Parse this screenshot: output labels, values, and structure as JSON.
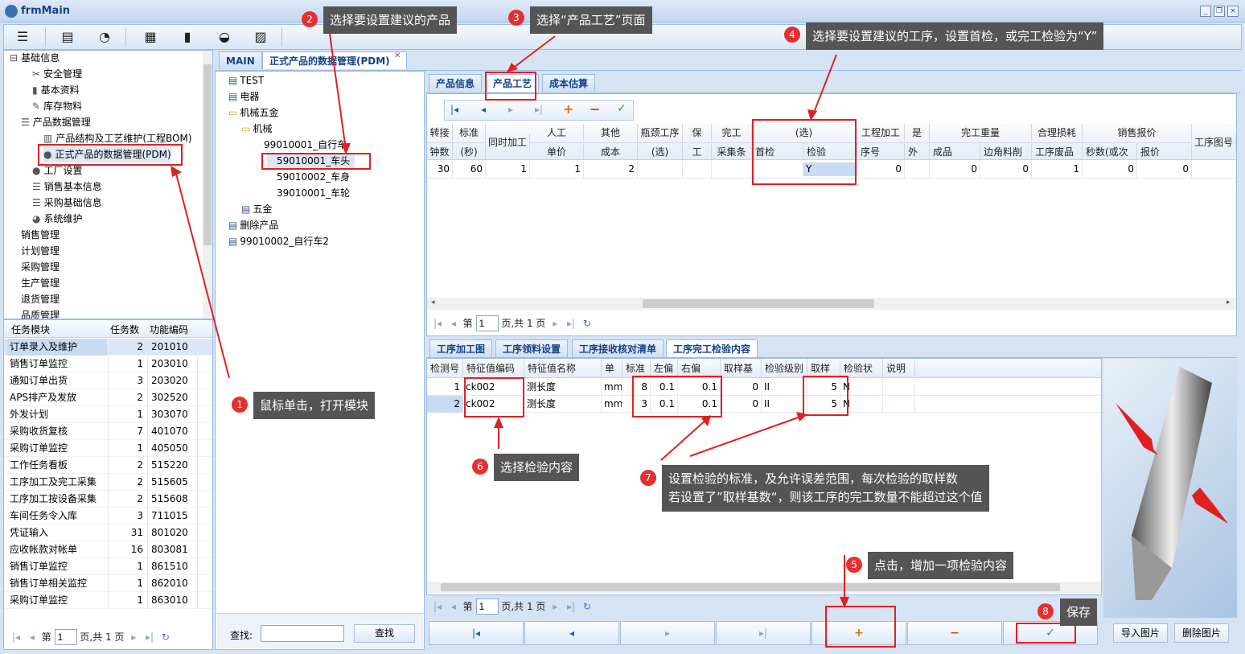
{
  "window": {
    "title": "frmMain"
  },
  "tree": [
    {
      "label": "基础信息",
      "icon": "minus-box",
      "indent": 0
    },
    {
      "label": "安全管理",
      "icon": "scissors",
      "indent": 2
    },
    {
      "label": "基本资料",
      "icon": "bookmark",
      "indent": 2
    },
    {
      "label": "库存物料",
      "icon": "edit",
      "indent": 2
    },
    {
      "label": "产品数据管理",
      "icon": "list",
      "indent": 1
    },
    {
      "label": "产品结构及工艺维护(工程BOM)",
      "icon": "chart",
      "indent": 3
    },
    {
      "label": "正式产品的数据管理(PDM)",
      "icon": "user",
      "indent": 3
    },
    {
      "label": "工厂设置",
      "icon": "user",
      "indent": 2
    },
    {
      "label": "销售基本信息",
      "icon": "list",
      "indent": 2
    },
    {
      "label": "采购基础信息",
      "icon": "list",
      "indent": 2
    },
    {
      "label": "系统维护",
      "icon": "pie",
      "indent": 2
    },
    {
      "label": "销售管理",
      "indent": 1
    },
    {
      "label": "计划管理",
      "indent": 1
    },
    {
      "label": "采购管理",
      "indent": 1
    },
    {
      "label": "生产管理",
      "indent": 1
    },
    {
      "label": "退货管理",
      "indent": 1
    },
    {
      "label": "品质管理",
      "indent": 1
    }
  ],
  "tasks": {
    "headers": [
      "任务模块",
      "任务数",
      "功能编码"
    ],
    "rows": [
      [
        "订单录入及维护",
        "2",
        "201010"
      ],
      [
        "销售订单监控",
        "1",
        "203010"
      ],
      [
        "通知订单出货",
        "3",
        "203020"
      ],
      [
        "APS排产及发放",
        "2",
        "302520"
      ],
      [
        "外发计划",
        "1",
        "303070"
      ],
      [
        "采购收货复核",
        "7",
        "401070"
      ],
      [
        "采购订单监控",
        "1",
        "405050"
      ],
      [
        "工作任务看板",
        "2",
        "515220"
      ],
      [
        "工序加工及完工采集",
        "2",
        "515605"
      ],
      [
        "工序加工按设备采集",
        "2",
        "515608"
      ],
      [
        "车间任务令入库",
        "3",
        "711015"
      ],
      [
        "凭证输入",
        "31",
        "801020"
      ],
      [
        "应收帐款对帐单",
        "16",
        "803081"
      ],
      [
        "销售订单监控",
        "1",
        "861510"
      ],
      [
        "销售订单相关监控",
        "1",
        "862010"
      ],
      [
        "采购订单监控",
        "1",
        "863010"
      ]
    ]
  },
  "pager_left": {
    "prefix": "第",
    "page": "1",
    "suffix": "页,共 1 页"
  },
  "main_tabs": [
    "MAIN",
    "正式产品的数据管理(PDM)"
  ],
  "product_tree": [
    {
      "label": "TEST",
      "indent": 0,
      "icon": "doc"
    },
    {
      "label": "电器",
      "indent": 0,
      "icon": "doc"
    },
    {
      "label": "机械五金",
      "indent": 0,
      "icon": "folder"
    },
    {
      "label": "机械",
      "indent": 1,
      "icon": "folder"
    },
    {
      "label": "99010001_自行车",
      "indent": 2,
      "icon": "none"
    },
    {
      "label": "59010001_车头",
      "indent": 3,
      "icon": "none"
    },
    {
      "label": "59010002_车身",
      "indent": 3,
      "icon": "none"
    },
    {
      "label": "39010001_车轮",
      "indent": 3,
      "icon": "none"
    },
    {
      "label": "五金",
      "indent": 1,
      "icon": "doc"
    },
    {
      "label": "删除产品",
      "indent": 0,
      "icon": "doc"
    },
    {
      "label": "99010002_自行车2",
      "indent": 0,
      "icon": "doc"
    }
  ],
  "search": {
    "label": "查找:",
    "button": "查找"
  },
  "product_tabs": [
    "产品信息",
    "产品工艺",
    "成本估算"
  ],
  "process_grid": {
    "headers_top": [
      "转接",
      "标准",
      "同时加工",
      "人工",
      "其他",
      "瓶颈工序",
      "保",
      "完工",
      "(选)",
      "工程加工",
      "是",
      "完工重量",
      "合理损耗",
      "销售报价",
      "工序图号"
    ],
    "headers_bottom": [
      "钟数",
      "(秒)",
      "单价",
      "成本",
      "(选)",
      "工",
      "采集条",
      "首检",
      "检验",
      "序号",
      "外",
      "成品",
      "边角料削",
      "工序废品",
      "秒数(或次",
      "报价"
    ],
    "row": [
      "30",
      "60",
      "1",
      "1",
      "2",
      "",
      "",
      "",
      "",
      "Y",
      "0",
      "",
      "0",
      "0",
      "1",
      "0",
      "0"
    ]
  },
  "pager_mid": {
    "prefix": "第",
    "page": "1",
    "suffix": "页,共 1 页"
  },
  "sub_tabs": [
    "工序加工图",
    "工序领料设置",
    "工序接收核对清单",
    "工序完工检验内容"
  ],
  "inspect_grid": {
    "headers": [
      "检测号",
      "特征值编码",
      "特征值名称",
      "单",
      "标准",
      "左偏",
      "右偏",
      "取样基",
      "检验级别",
      "取样",
      "检验状",
      "说明"
    ],
    "rows": [
      [
        "1",
        "ck002",
        "测长度",
        "mm",
        "8",
        "0.1",
        "0.1",
        "0",
        "II",
        "5",
        "N",
        ""
      ],
      [
        "2",
        "ck002",
        "测长度",
        "mm",
        "3",
        "0.1",
        "0.1",
        "0",
        "II",
        "5",
        "N",
        ""
      ]
    ]
  },
  "pager_bot": {
    "prefix": "第",
    "page": "1",
    "suffix": "页,共 1 页"
  },
  "image_buttons": {
    "import": "导入图片",
    "delete": "删除图片"
  },
  "callouts": [
    {
      "n": "1",
      "text": "鼠标单击，打开模块"
    },
    {
      "n": "2",
      "text": "选择要设置建议的产品"
    },
    {
      "n": "3",
      "text": "选择“产品工艺”页面"
    },
    {
      "n": "4",
      "text": "选择要设置建议的工序，设置首检，或完工检验为“Y”"
    },
    {
      "n": "5",
      "text": "点击，增加一项检验内容"
    },
    {
      "n": "6",
      "text": "选择检验内容"
    },
    {
      "n": "7",
      "text": "设置检验的标准，及允许误差范围，每次检验的取样数",
      "text2": "若设置了”取样基数“，则该工序的完工数量不能超过这个值"
    },
    {
      "n": "8",
      "text": "保存"
    }
  ]
}
